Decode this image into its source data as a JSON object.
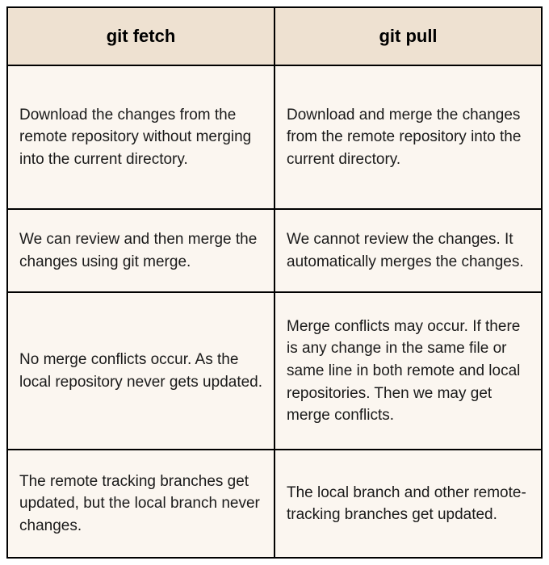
{
  "table": {
    "headers": [
      "git fetch",
      "git pull"
    ],
    "rows": [
      {
        "fetch": "Download the changes from the remote repository without merging into the current directory.",
        "pull": "Download and merge the changes from the remote repository into the current directory."
      },
      {
        "fetch": "We can review and then merge the changes using git merge.",
        "pull": "We cannot review the changes. It automatically merges the changes."
      },
      {
        "fetch": "No merge conflicts occur. As the local repository never gets updated.",
        "pull": "Merge conflicts may occur. If there is any change in the same file or same line in both remote and local repositories. Then we may get merge conflicts."
      },
      {
        "fetch": "The remote tracking branches get updated, but the local branch never changes.",
        "pull": "The local branch and other remote-tracking branches get updated."
      }
    ]
  }
}
